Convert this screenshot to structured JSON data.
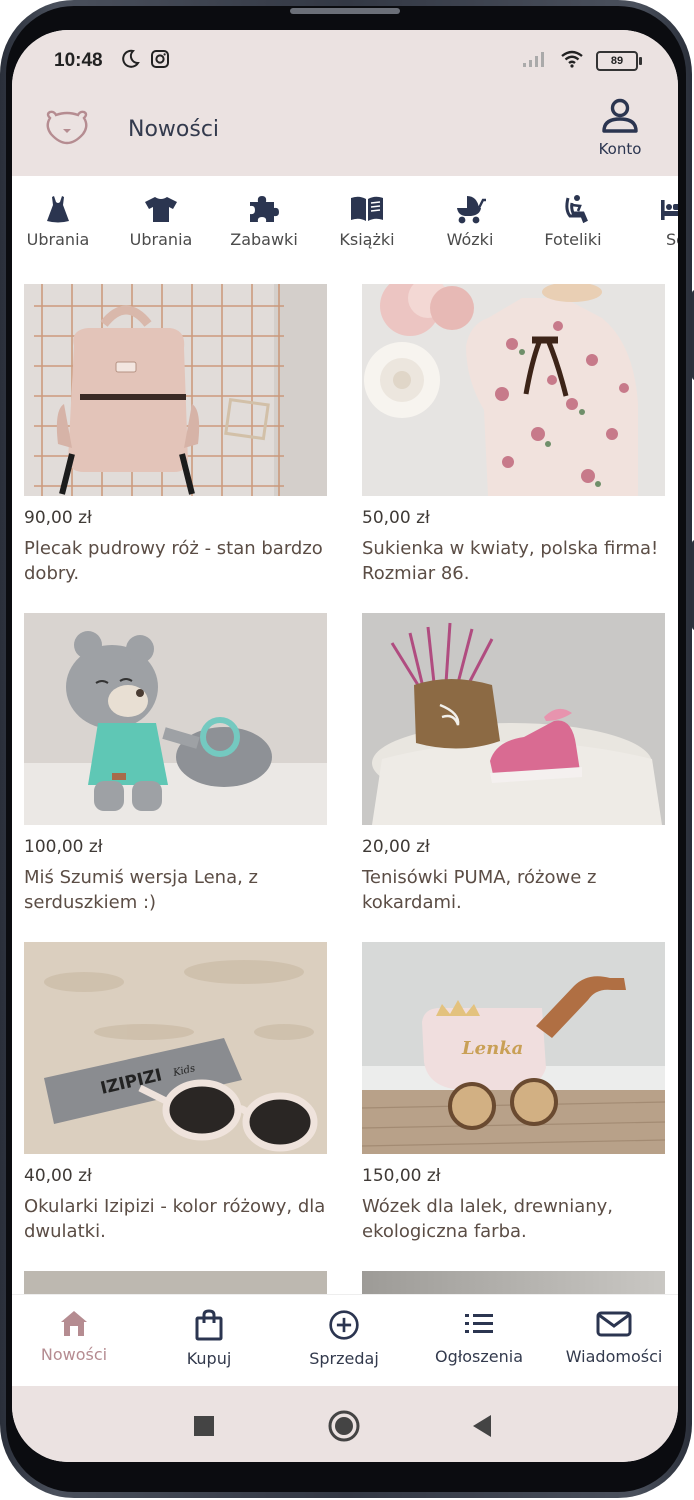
{
  "status_bar": {
    "time": "10:48",
    "battery": "89"
  },
  "app_bar": {
    "title": "Nowości",
    "account_label": "Konto"
  },
  "categories": [
    {
      "label": "Ubrania",
      "icon": "dress-icon"
    },
    {
      "label": "Ubrania",
      "icon": "tshirt-icon"
    },
    {
      "label": "Zabawki",
      "icon": "puzzle-icon"
    },
    {
      "label": "Książki",
      "icon": "book-icon"
    },
    {
      "label": "Wózki",
      "icon": "stroller-icon"
    },
    {
      "label": "Foteliki",
      "icon": "car-seat-icon"
    },
    {
      "label": "Se",
      "icon": "bed-icon"
    }
  ],
  "listings": [
    {
      "price": "90,00 zł",
      "title": "Plecak pudrowy róż - stan bardzo dobry."
    },
    {
      "price": "50,00 zł",
      "title": "Sukienka w kwiaty, polska firma! Rozmiar 86."
    },
    {
      "price": "100,00 zł",
      "title": "Miś Szumiś wersja Lena, z serduszkiem :)"
    },
    {
      "price": "20,00 zł",
      "title": "Tenisówki PUMA, różowe z kokardami."
    },
    {
      "price": "40,00 zł",
      "title": "Okularki Izipizi - kolor różowy, dla dwulatki."
    },
    {
      "price": "150,00 zł",
      "title": "Wózek dla lalek, drewniany, ekologiczna farba."
    }
  ],
  "product_image_text": {
    "sunglasses_box": "IZIPIZI",
    "sunglasses_box_sub": "Kids",
    "doll_pram_name": "Lenka"
  },
  "bottom_nav": [
    {
      "label": "Nowości",
      "icon": "home-icon",
      "active": true
    },
    {
      "label": "Kupuj",
      "icon": "shopping-bag-icon",
      "active": false
    },
    {
      "label": "Sprzedaj",
      "icon": "plus-circle-icon",
      "active": false
    },
    {
      "label": "Ogłoszenia",
      "icon": "list-icon",
      "active": false
    },
    {
      "label": "Wiadomości",
      "icon": "envelope-icon",
      "active": false
    }
  ],
  "colors": {
    "header_bg": "#ebe2e1",
    "accent": "#b58c91",
    "icon_navy": "#2b3550",
    "text_brown": "#5b4d45"
  }
}
